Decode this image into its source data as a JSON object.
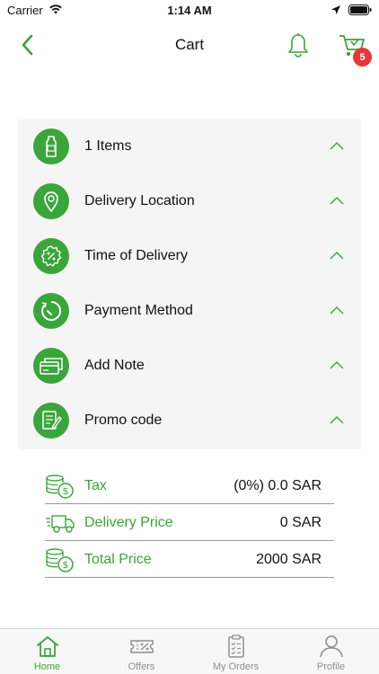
{
  "status_bar": {
    "carrier": "Carrier",
    "time": "1:14 AM",
    "icons": [
      "wifi-icon",
      "location-arrow-icon",
      "battery-icon"
    ]
  },
  "nav": {
    "title": "Cart",
    "back_icon": "chevron-left-icon",
    "bell_icon": "bell-icon",
    "cart_icon": "cart-icon",
    "cart_count": "5"
  },
  "sections": [
    {
      "label": "1  Items",
      "icon": "bottle-icon"
    },
    {
      "label": "Delivery Location",
      "icon": "location-pin-icon"
    },
    {
      "label": "Time of Delivery",
      "icon": "discount-badge-icon"
    },
    {
      "label": "Payment Method",
      "icon": "timer-icon"
    },
    {
      "label": "Add Note",
      "icon": "card-icon"
    },
    {
      "label": "Promo code",
      "icon": "note-pencil-icon"
    }
  ],
  "summary": {
    "tax_label": "Tax",
    "tax_value": "(0%) 0.0 SAR",
    "delivery_label": "Delivery Price",
    "delivery_value": "0 SAR",
    "total_label": "Total Price",
    "total_value": "2000 SAR"
  },
  "tabs": [
    {
      "label": "Home",
      "icon": "home-icon",
      "active": true
    },
    {
      "label": "Offers",
      "icon": "ticket-icon",
      "active": false
    },
    {
      "label": "My Orders",
      "icon": "clipboard-icon",
      "active": false
    },
    {
      "label": "Profile",
      "icon": "person-icon",
      "active": false
    }
  ],
  "colors": {
    "accent": "#3aa53a",
    "badge": "#e53935",
    "panel": "#f5f5f5"
  }
}
